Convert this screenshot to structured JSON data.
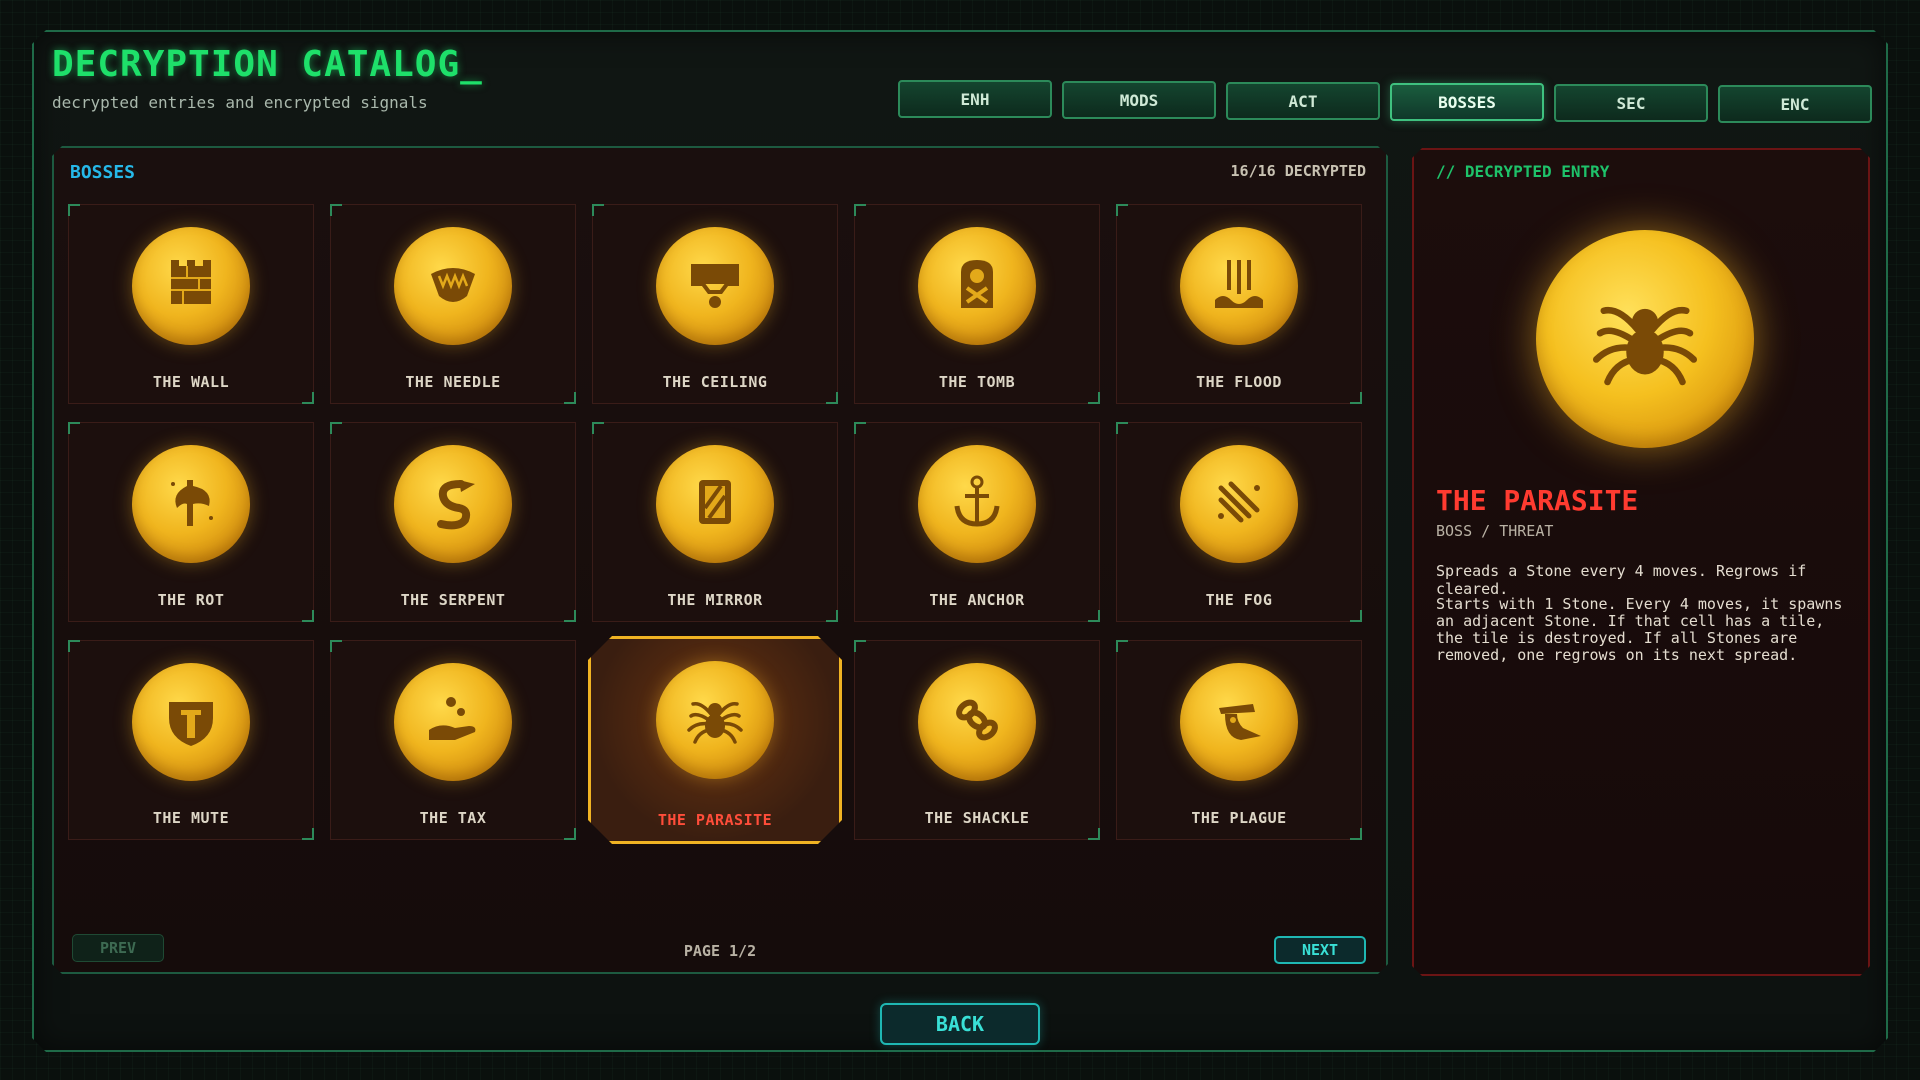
{
  "header": {
    "title": "DECRYPTION CATALOG_",
    "subtitle": "decrypted entries and encrypted signals"
  },
  "tabs": [
    {
      "label": "ENH",
      "active": false
    },
    {
      "label": "MODS",
      "active": false
    },
    {
      "label": "ACT",
      "active": false
    },
    {
      "label": "BOSSES",
      "active": true
    },
    {
      "label": "SEC",
      "active": false
    },
    {
      "label": "ENC",
      "active": false
    }
  ],
  "grid": {
    "label": "BOSSES",
    "count": "16/16 DECRYPTED",
    "cards": [
      {
        "name": "THE WALL",
        "icon": "wall-icon"
      },
      {
        "name": "THE NEEDLE",
        "icon": "needle-icon"
      },
      {
        "name": "THE CEILING",
        "icon": "ceiling-icon"
      },
      {
        "name": "THE TOMB",
        "icon": "tomb-icon"
      },
      {
        "name": "THE FLOOD",
        "icon": "flood-icon"
      },
      {
        "name": "THE ROT",
        "icon": "rot-icon"
      },
      {
        "name": "THE SERPENT",
        "icon": "serpent-icon"
      },
      {
        "name": "THE MIRROR",
        "icon": "mirror-icon"
      },
      {
        "name": "THE ANCHOR",
        "icon": "anchor-icon"
      },
      {
        "name": "THE FOG",
        "icon": "fog-icon"
      },
      {
        "name": "THE MUTE",
        "icon": "mute-icon"
      },
      {
        "name": "THE TAX",
        "icon": "tax-icon"
      },
      {
        "name": "THE PARASITE",
        "icon": "spider-icon",
        "selected": true
      },
      {
        "name": "THE SHACKLE",
        "icon": "shackle-icon"
      },
      {
        "name": "THE PLAGUE",
        "icon": "plague-icon"
      }
    ],
    "prev_label": "PREV",
    "next_label": "NEXT",
    "page_indicator": "PAGE 1/2"
  },
  "detail": {
    "label": "// DECRYPTED ENTRY",
    "icon": "spider-icon",
    "name": "THE PARASITE",
    "type": "BOSS / THREAT",
    "short": "Spreads a Stone every 4 moves. Regrows if cleared.",
    "long": "Starts with 1 Stone. Every 4 moves, it spawns an adjacent Stone. If that cell has a tile, the tile is destroyed. If all Stones are removed, one regrows on its next spread."
  },
  "footer": {
    "back_label": "BACK"
  },
  "colors": {
    "accent_green": "#1ee06a",
    "accent_cyan": "#26b8e8",
    "alert_red": "#ff3b30",
    "coin_gold": "#f0b51e"
  }
}
